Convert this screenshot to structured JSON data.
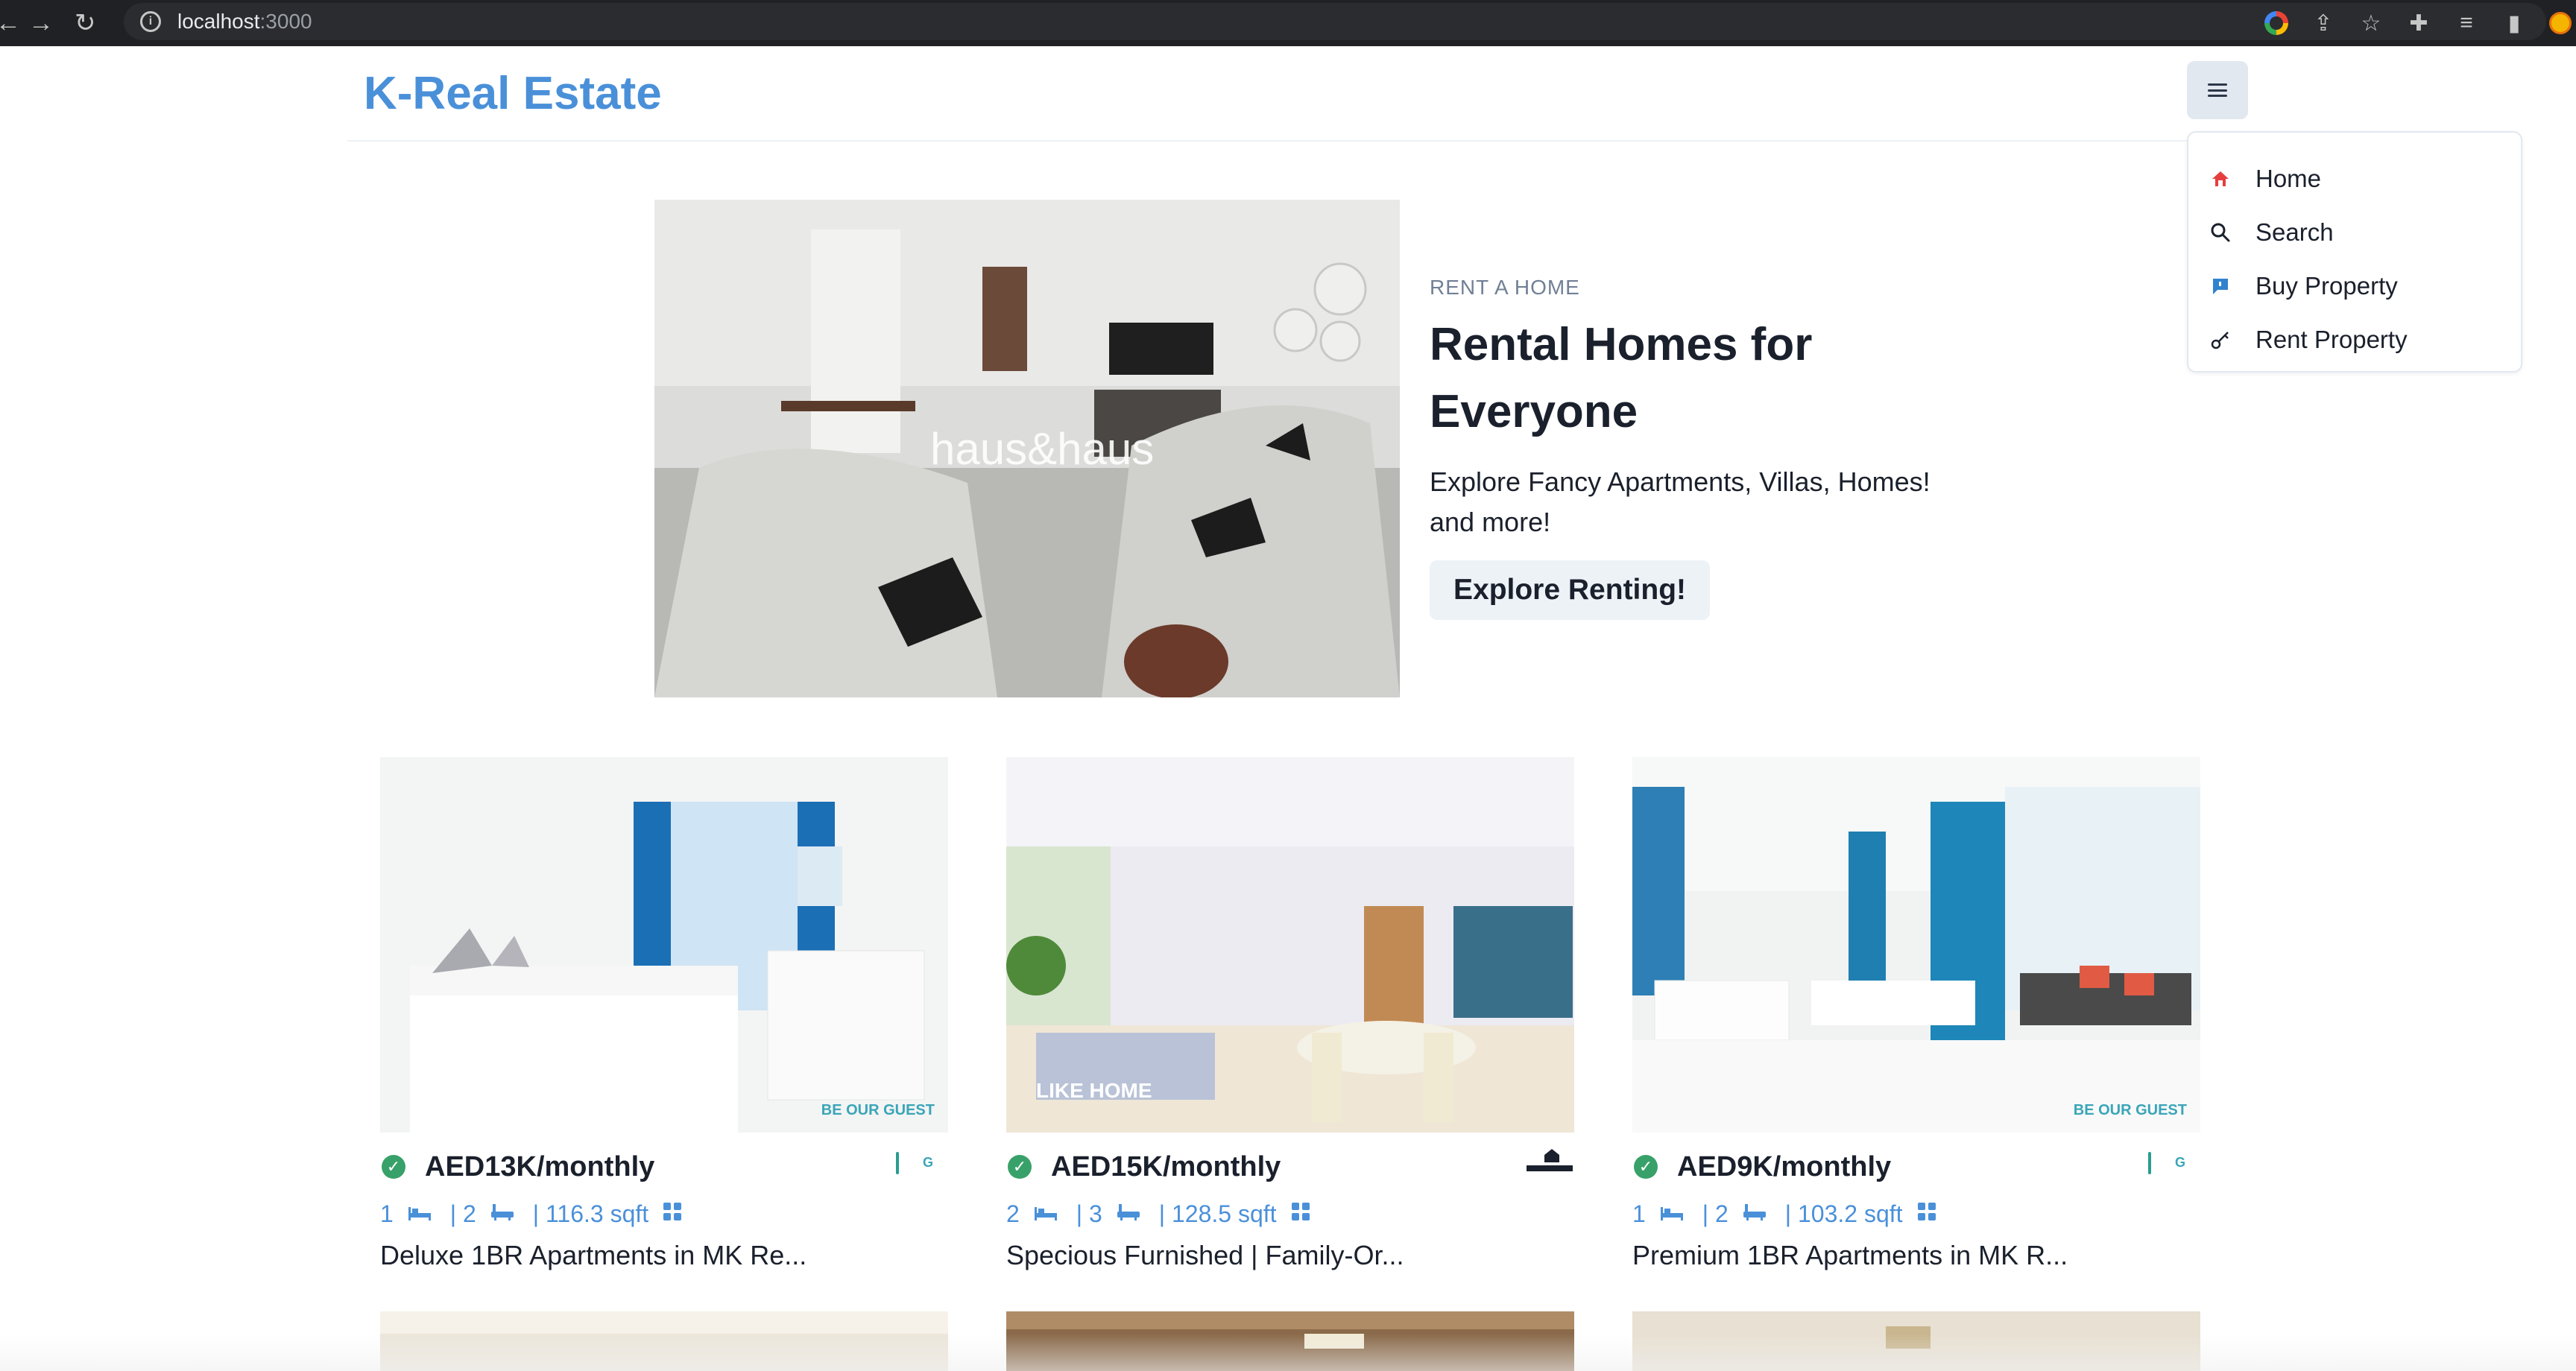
{
  "browser": {
    "url_host": "localhost",
    "url_port": ":3000"
  },
  "navbar": {
    "brand": "K-Real Estate"
  },
  "menu": {
    "items": [
      {
        "label": "Home",
        "icon": "home-icon"
      },
      {
        "label": "Search",
        "icon": "search-icon"
      },
      {
        "label": "Buy Property",
        "icon": "chat-icon"
      },
      {
        "label": "Rent Property",
        "icon": "key-icon"
      }
    ]
  },
  "banner": {
    "eyebrow": "RENT A HOME",
    "title_line1": "Rental Homes for",
    "title_line2": "Everyone",
    "desc_line1": "Explore Fancy Apartments, Villas, Homes!",
    "desc_line2": "and more!",
    "button": "Explore Renting!",
    "image_watermark": "haus&haus"
  },
  "properties": [
    {
      "price": "AED13K/monthly",
      "rooms": "1",
      "baths": "| 2",
      "area": "| 116.3 sqft",
      "title": "Deluxe 1BR Apartments in MK Re...",
      "watermark": "BE OUR GUEST"
    },
    {
      "price": "AED15K/monthly",
      "rooms": "2",
      "baths": "| 3",
      "area": "| 128.5 sqft",
      "title": "Specious Furnished | Family-Or...",
      "watermark": "LIKE HOME"
    },
    {
      "price": "AED9K/monthly",
      "rooms": "1",
      "baths": "| 2",
      "area": "| 103.2 sqft",
      "title": "Premium 1BR Apartments in MK R...",
      "watermark": "BE OUR GUEST"
    }
  ],
  "colors": {
    "brand": "#4a90d9",
    "verified": "#38a169",
    "spec_blue": "#4a90d9"
  }
}
